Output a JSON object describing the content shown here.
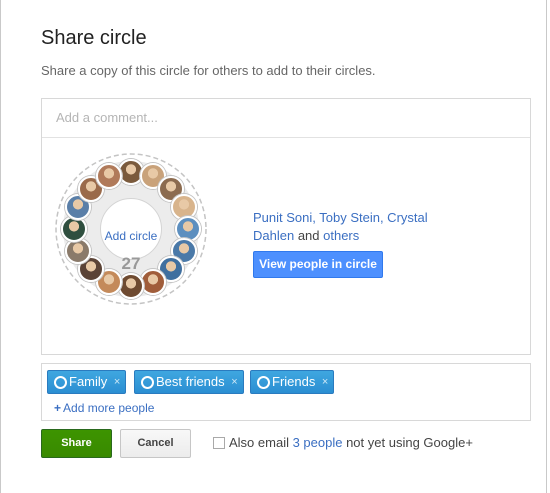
{
  "dialog": {
    "title": "Share circle",
    "subtitle": "Share a copy of this circle for others to add to their circles."
  },
  "comment": {
    "placeholder": "Add a comment..."
  },
  "circle": {
    "add_label": "Add circle",
    "count": "27",
    "people_names": "Punit Soni, Toby Stein, Crystal Dahlen",
    "and_text": " and ",
    "others_link": "others",
    "view_button": "View people in circle",
    "avatar_colors": [
      "#7a5a3c",
      "#c9a27a",
      "#8c6b4f",
      "#d8b48c",
      "#5d8fbf",
      "#4a79a8",
      "#3f6f9f",
      "#a05d3a",
      "#6e4a30",
      "#c48a5a",
      "#5b4336",
      "#8a7a6a",
      "#2f4f3f",
      "#5a7fa8",
      "#9a6a4a",
      "#b07a5a"
    ]
  },
  "audience": {
    "chips": [
      {
        "label": "Family"
      },
      {
        "label": "Best friends"
      },
      {
        "label": "Friends"
      }
    ],
    "remove_glyph": "×",
    "add_more_plus": "+",
    "add_more_label": "Add more people"
  },
  "actions": {
    "share_label": "Share",
    "cancel_label": "Cancel",
    "email_prefix": "Also email ",
    "email_count_link": "3 people",
    "email_suffix": " not yet using Google+"
  }
}
